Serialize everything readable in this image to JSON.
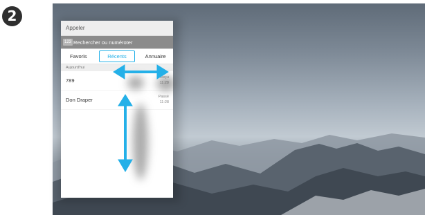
{
  "step": {
    "number": "2"
  },
  "panel": {
    "title": "Appeler",
    "search": {
      "keypad_label": "123",
      "placeholder": "Rechercher ou numéroter"
    },
    "tabs": [
      {
        "label": "Favoris",
        "active": false
      },
      {
        "label": "Récents",
        "active": true
      },
      {
        "label": "Annuaire",
        "active": false
      }
    ],
    "section_label": "Aujourd'hui",
    "calls": [
      {
        "name": "789",
        "status": "Reçu",
        "time": "11:28"
      },
      {
        "name": "Don Draper",
        "status": "Passé",
        "time": "11:28"
      }
    ]
  },
  "colors": {
    "accent": "#24b0e8",
    "badge": "#2f2f2f"
  },
  "icons": {
    "horizontal_arrow": "double-arrow-horizontal-icon",
    "vertical_arrow": "double-arrow-vertical-icon"
  }
}
